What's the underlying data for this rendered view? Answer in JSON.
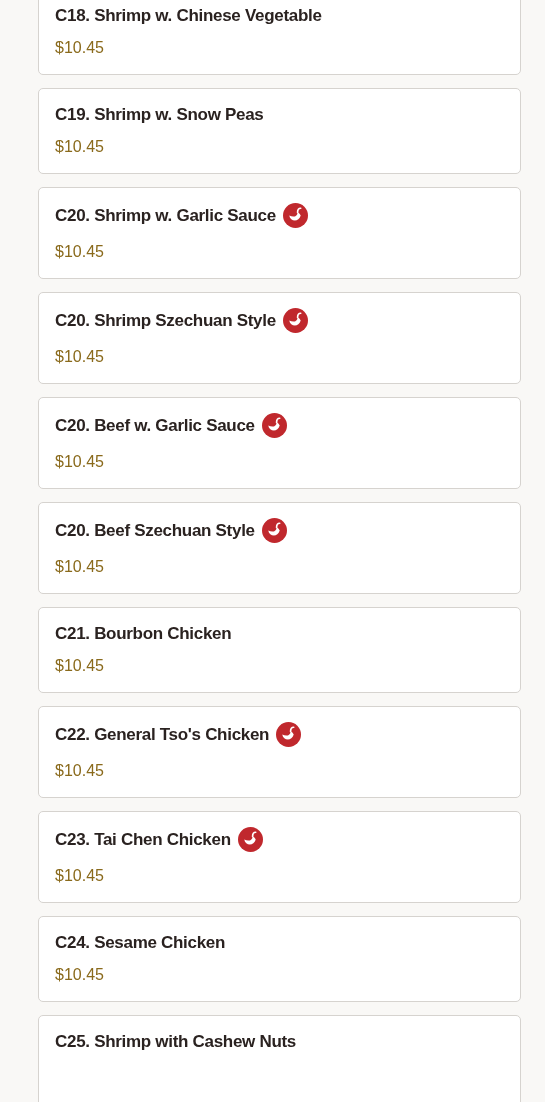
{
  "menu_items": [
    {
      "name": "C18. Shrimp w. Chinese Vegetable",
      "price": "$10.45",
      "spicy": false
    },
    {
      "name": "C19. Shrimp w. Snow Peas",
      "price": "$10.45",
      "spicy": false
    },
    {
      "name": "C20. Shrimp w. Garlic Sauce",
      "price": "$10.45",
      "spicy": true
    },
    {
      "name": "C20. Shrimp Szechuan Style",
      "price": "$10.45",
      "spicy": true
    },
    {
      "name": "C20. Beef w. Garlic Sauce",
      "price": "$10.45",
      "spicy": true
    },
    {
      "name": "C20. Beef Szechuan Style",
      "price": "$10.45",
      "spicy": true
    },
    {
      "name": "C21. Bourbon Chicken",
      "price": "$10.45",
      "spicy": false
    },
    {
      "name": "C22. General Tso's Chicken",
      "price": "$10.45",
      "spicy": true
    },
    {
      "name": "C23. Tai Chen Chicken",
      "price": "$10.45",
      "spicy": true
    },
    {
      "name": "C24. Sesame Chicken",
      "price": "$10.45",
      "spicy": false
    },
    {
      "name": "C25. Shrimp with Cashew Nuts",
      "spicy": false
    }
  ]
}
